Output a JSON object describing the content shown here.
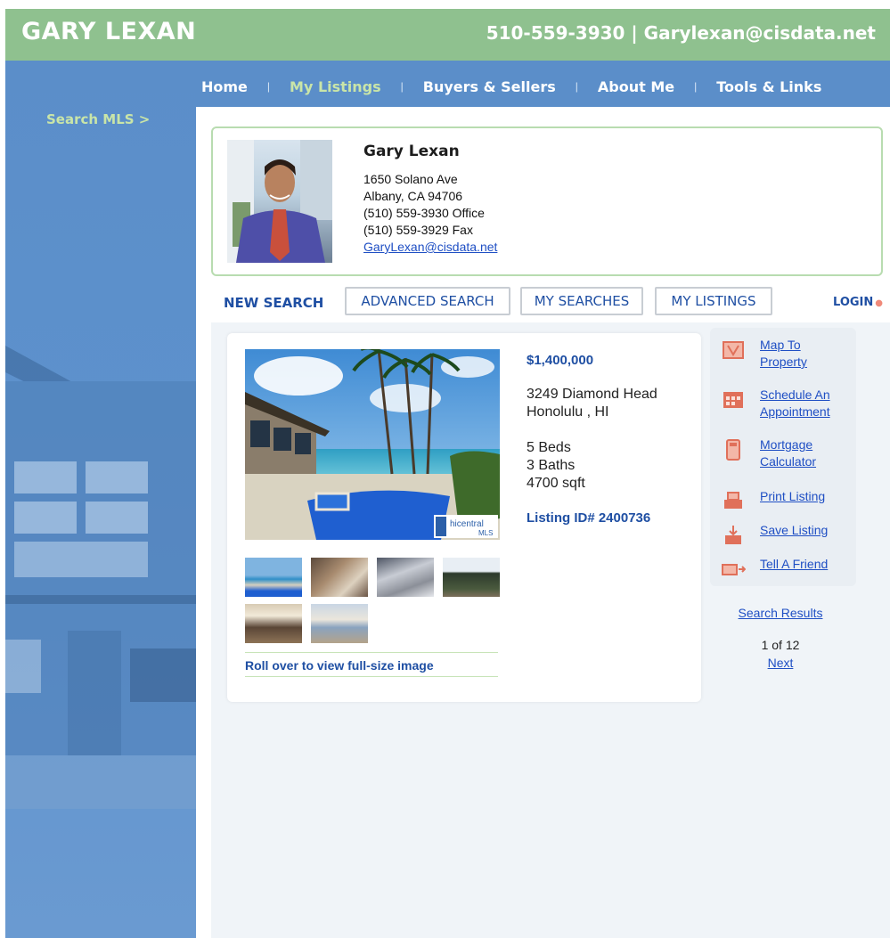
{
  "header": {
    "site_name": "GARY LEXAN",
    "contact_line": "510-559-3930 | Garylexan@cisdata.net"
  },
  "nav": {
    "items": [
      {
        "label": "Home",
        "active": false
      },
      {
        "label": "My Listings",
        "active": true
      },
      {
        "label": "Buyers & Sellers",
        "active": false
      },
      {
        "label": "About Me",
        "active": false
      },
      {
        "label": "Tools & Links",
        "active": false
      }
    ],
    "separator": "|"
  },
  "sidebar": {
    "search_mls": "Search MLS >"
  },
  "agent": {
    "name": "Gary Lexan",
    "address_line1": "1650 Solano Ave",
    "address_line2": "Albany, CA 94706",
    "office_phone": "(510) 559-3930 Office",
    "fax": "(510) 559-3929 Fax",
    "email": "GaryLexan@cisdata.net"
  },
  "tabs": {
    "new_search": "NEW SEARCH",
    "advanced_search": "ADVANCED SEARCH",
    "my_searches": "MY SEARCHES",
    "my_listings": "MY LISTINGS",
    "login": "LOGIN"
  },
  "listing": {
    "price": "$1,400,000",
    "street": "3249 Diamond Head",
    "city": "Honolulu , HI",
    "beds": "5 Beds",
    "baths": "3 Baths",
    "sqft": "4700 sqft",
    "listing_id": "Listing ID# 2400736",
    "photo_watermark_1": "hicentral",
    "photo_watermark_2": "MLS",
    "roll_over_note": "Roll over to view full-size image"
  },
  "tools": {
    "map_1": "Map To",
    "map_2": "Property",
    "schedule_1": "Schedule An",
    "schedule_2": "Appointment",
    "mortgage_1": "Mortgage",
    "mortgage_2": "Calculator",
    "print": "Print Listing",
    "save": "Save Listing",
    "tell": "Tell A Friend"
  },
  "results": {
    "search_results": "Search Results",
    "count": "1 of 12",
    "next": "Next"
  },
  "colors": {
    "header_green": "#8fc18f",
    "nav_blue": "#5b8ec9",
    "link_blue": "#1f4fc4",
    "heading_blue": "#1f4fa3",
    "active_nav": "#c9e5a8"
  }
}
